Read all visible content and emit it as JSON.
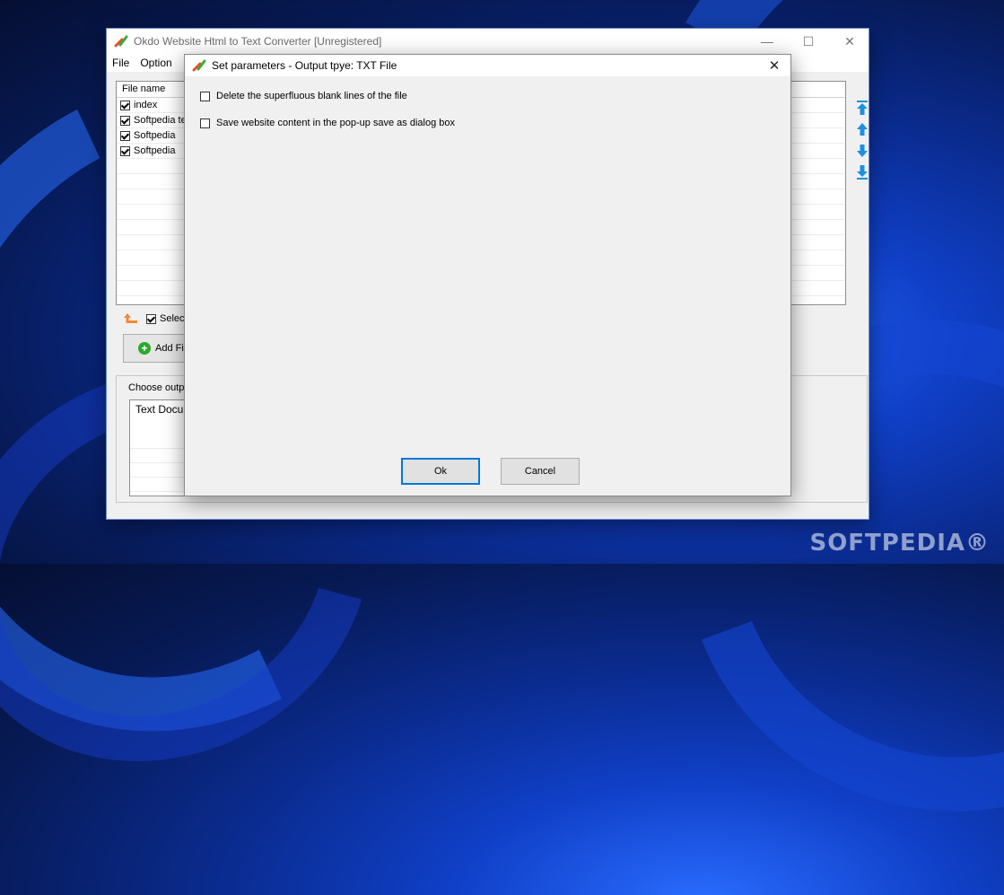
{
  "main_window": {
    "title": "Okdo Website Html to Text Converter [Unregistered]",
    "controls": {
      "minimize": "—",
      "maximize": "☐",
      "close": "✕"
    }
  },
  "menu": [
    "File",
    "Option"
  ],
  "file_list": {
    "header": "File name",
    "rows": [
      {
        "name": "index",
        "checked": true
      },
      {
        "name": "Softpedia te",
        "checked": true
      },
      {
        "name": "Softpedia",
        "checked": true
      },
      {
        "name": "Softpedia",
        "checked": true
      }
    ]
  },
  "select_all_label": "Selec",
  "add_files_label": "Add Fi",
  "output": {
    "group_label": "Choose outpu",
    "selected": "Text Docu"
  },
  "dialog": {
    "title": "Set parameters - Output tpye: TXT File",
    "close": "✕",
    "options": [
      {
        "label": "Delete the superfluous blank lines of the file",
        "checked": false
      },
      {
        "label": "Save website content in the pop-up save as dialog box",
        "checked": false
      }
    ],
    "ok_label": "Ok",
    "cancel_label": "Cancel"
  },
  "watermark": "SOFTPEDIA®",
  "colors": {
    "accent": "#0078d7",
    "arrow": "#1e90e0",
    "plus": "#2da82d",
    "up_arrow_orange": "#f0883a"
  }
}
